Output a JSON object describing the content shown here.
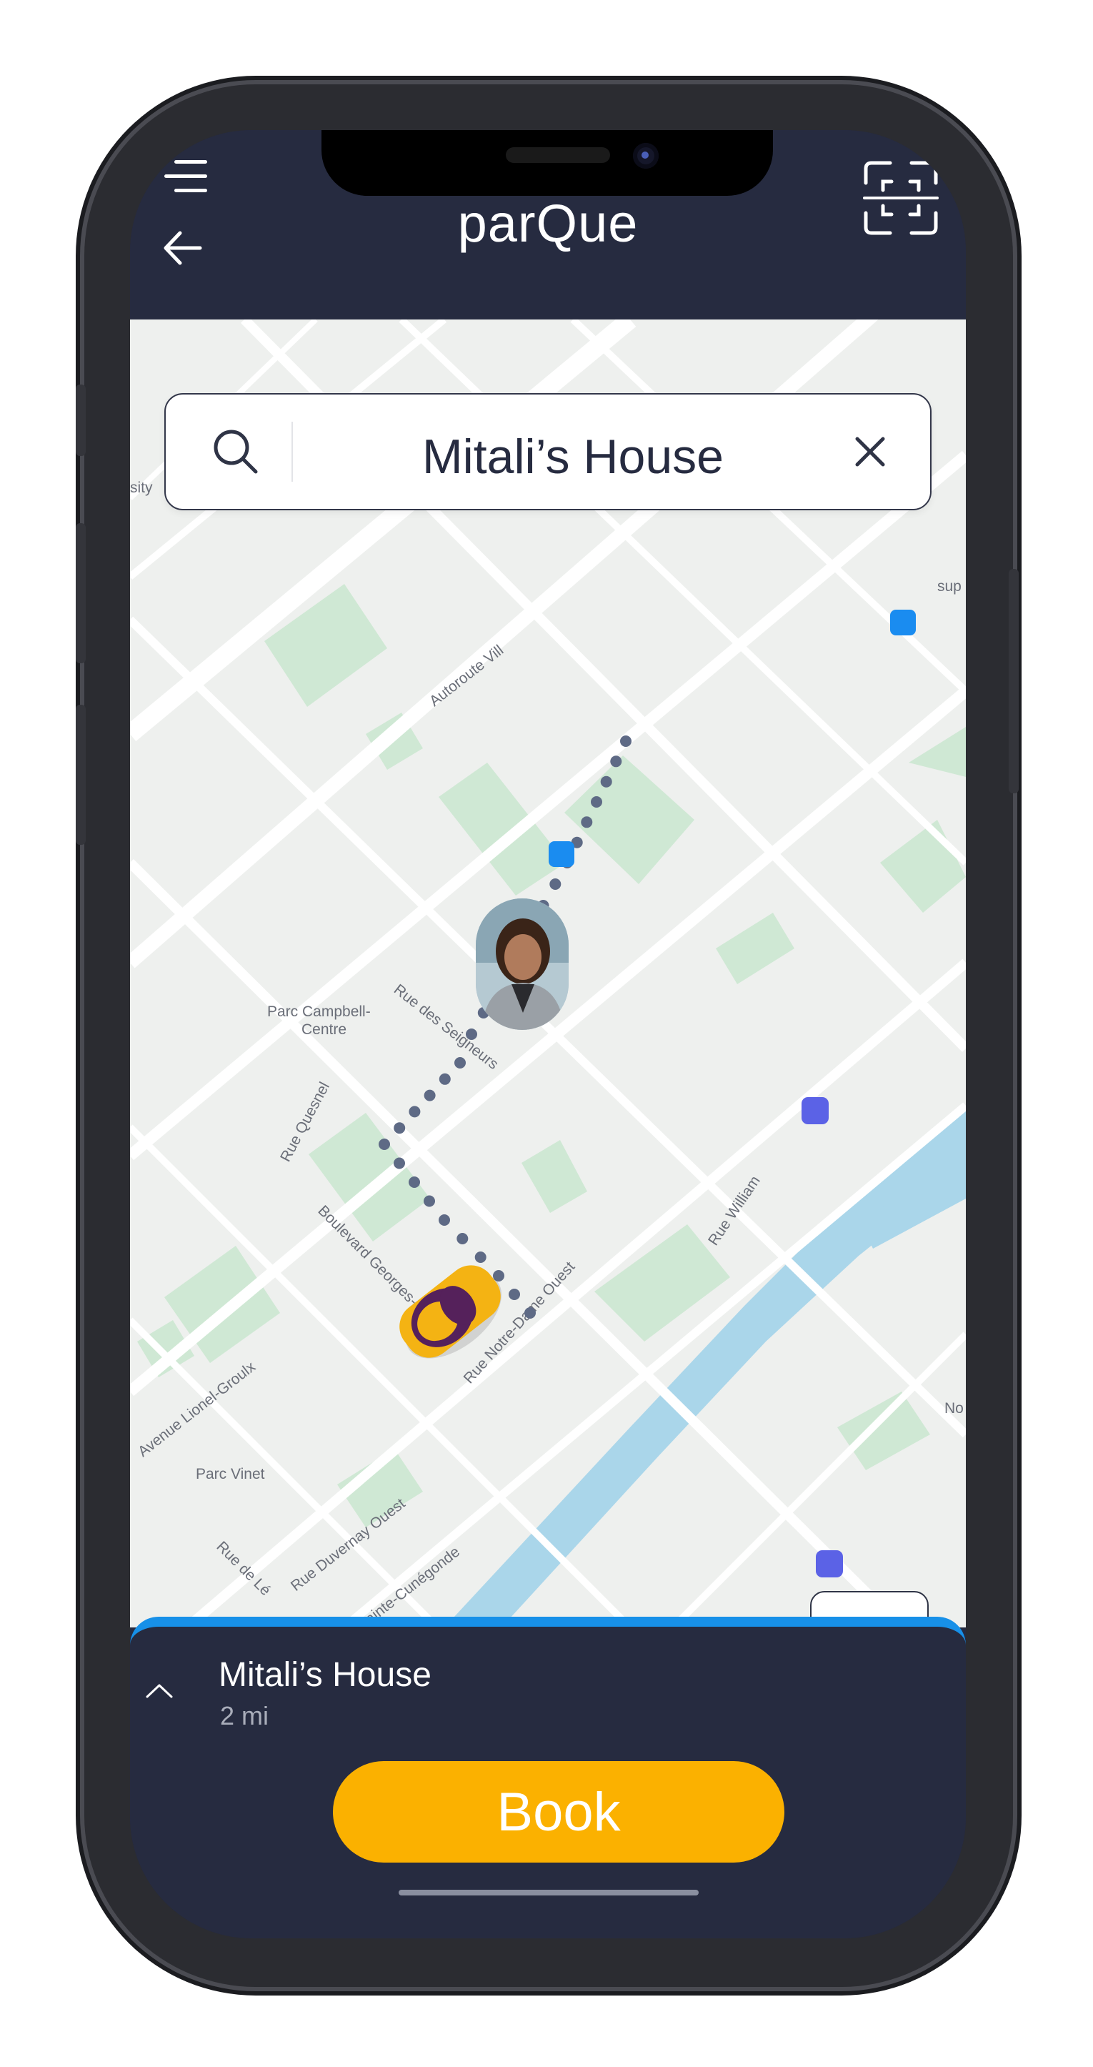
{
  "header": {
    "app_title": "parQue"
  },
  "search": {
    "query": "Mitali’s House"
  },
  "map": {
    "labels": {
      "parc_campbell": "Parc Campbell-",
      "parc_campbell_2": "Centre",
      "rue_des_seigneurs": "Rue des Seigneurs",
      "rue_quesnel": "Rue Quesnel",
      "boulevard_georges_vanier": "Boulevard Georges-Vanier",
      "rue_notre_dame_ouest": "Rue Notre-Dame Ouest",
      "rue_william": "Rue William",
      "avenue_lionel_groulx": "Avenue Lionel-Groulx",
      "parc_vinet": "Parc Vinet",
      "rue_duvernay_ouest": "Rue Duvernay Ouest",
      "rue_sainte_cunegonde": "Rue Sainte-Cunégonde",
      "autoroute_ville": "Autoroute Vill",
      "rue_de_le": "Rue de Lé",
      "sity": "sity",
      "sup": "sup",
      "no": "No",
      "ru": "Ru"
    },
    "marker_colors": {
      "blue": "#1a8cf0",
      "purple": "#5b62e6",
      "route": "#5e6a85",
      "car": "#f4b313"
    }
  },
  "destination": {
    "name": "Mitali’s House",
    "distance": "2 mi"
  },
  "actions": {
    "book_label": "Book"
  },
  "icons": [
    "menu-icon",
    "back-icon",
    "scan-icon",
    "search-icon",
    "clear-icon",
    "locate-icon",
    "chevron-up-icon",
    "car-icon",
    "avatar"
  ]
}
